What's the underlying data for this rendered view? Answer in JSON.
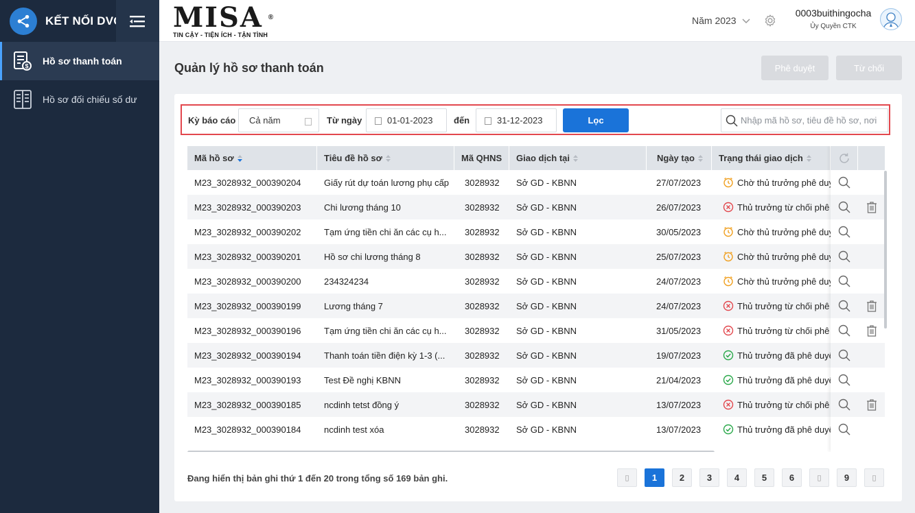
{
  "sidebar": {
    "app_title": "KẾT NỐI DVC",
    "items": [
      {
        "label": "Hồ sơ thanh toán",
        "active": true
      },
      {
        "label": "Hồ sơ đối chiếu số dư",
        "active": false
      }
    ]
  },
  "header": {
    "brand": "MISA",
    "brand_reg": "®",
    "tagline": "TIN CẬY - TIỆN ÍCH - TẬN TÌNH",
    "year": "Năm 2023",
    "user_name": "0003buithingocha",
    "user_role": "Ủy Quyền CTK"
  },
  "page": {
    "title": "Quản lý hồ sơ thanh toán",
    "approve_label": "Phê duyệt",
    "reject_label": "Từ chối"
  },
  "filter": {
    "period_label": "Kỳ báo cáo",
    "period_value": "Cả năm",
    "from_label": "Từ ngày",
    "from_value": "01-01-2023",
    "to_label": "đến",
    "to_value": "31-12-2023",
    "filter_button": "Lọc",
    "search_placeholder": "Nhập mã hồ sơ, tiêu đề hồ sơ, nơi"
  },
  "table": {
    "columns": [
      "Mã hồ sơ",
      "Tiêu đề hồ sơ",
      "Mã QHNS",
      "Giao dịch tại",
      "Ngày tạo",
      "Trạng thái giao dịch"
    ],
    "rows": [
      {
        "code": "M23_3028932_000390204",
        "title": "Giấy rút dự toán lương phụ cấp",
        "qhns": "3028932",
        "place": "Sở GD - KBNN",
        "date": "27/07/2023",
        "status": "Chờ thủ trưởng phê duy",
        "status_type": "pending",
        "deletable": false
      },
      {
        "code": "M23_3028932_000390203",
        "title": "Chi lương tháng 10",
        "qhns": "3028932",
        "place": "Sở GD - KBNN",
        "date": "26/07/2023",
        "status": "Thủ trưởng từ chối phê",
        "status_type": "rejected",
        "deletable": true
      },
      {
        "code": "M23_3028932_000390202",
        "title": "Tạm ứng tiền chi ăn các cụ h...",
        "qhns": "3028932",
        "place": "Sở GD - KBNN",
        "date": "30/05/2023",
        "status": "Chờ thủ trưởng phê duy",
        "status_type": "pending",
        "deletable": false
      },
      {
        "code": "M23_3028932_000390201",
        "title": "Hồ sơ chi lương tháng 8",
        "qhns": "3028932",
        "place": "Sở GD - KBNN",
        "date": "25/07/2023",
        "status": "Chờ thủ trưởng phê duy",
        "status_type": "pending",
        "deletable": false
      },
      {
        "code": "M23_3028932_000390200",
        "title": "234324234",
        "qhns": "3028932",
        "place": "Sở GD - KBNN",
        "date": "24/07/2023",
        "status": "Chờ thủ trưởng phê duy",
        "status_type": "pending",
        "deletable": false
      },
      {
        "code": "M23_3028932_000390199",
        "title": "Lương tháng 7",
        "qhns": "3028932",
        "place": "Sở GD - KBNN",
        "date": "24/07/2023",
        "status": "Thủ trưởng từ chối phê",
        "status_type": "rejected",
        "deletable": true
      },
      {
        "code": "M23_3028932_000390196",
        "title": "Tạm ứng tiền chi ăn các cụ h...",
        "qhns": "3028932",
        "place": "Sở GD - KBNN",
        "date": "31/05/2023",
        "status": "Thủ trưởng từ chối phê",
        "status_type": "rejected",
        "deletable": true
      },
      {
        "code": "M23_3028932_000390194",
        "title": "Thanh toán tiền điện kỳ 1-3 (...",
        "qhns": "3028932",
        "place": "Sở GD - KBNN",
        "date": "19/07/2023",
        "status": "Thủ trưởng đã phê duyệ",
        "status_type": "approved",
        "deletable": false
      },
      {
        "code": "M23_3028932_000390193",
        "title": "Test Đề nghị KBNN",
        "qhns": "3028932",
        "place": "Sở GD - KBNN",
        "date": "21/04/2023",
        "status": "Thủ trưởng đã phê duyệ",
        "status_type": "approved",
        "deletable": false
      },
      {
        "code": "M23_3028932_000390185",
        "title": "ncdinh tetst đồng ý",
        "qhns": "3028932",
        "place": "Sở GD - KBNN",
        "date": "13/07/2023",
        "status": "Thủ trưởng từ chối phê",
        "status_type": "rejected",
        "deletable": true
      },
      {
        "code": "M23_3028932_000390184",
        "title": "ncdinh test xóa",
        "qhns": "3028932",
        "place": "Sở GD - KBNN",
        "date": "13/07/2023",
        "status": "Thủ trưởng đã phê duyệ",
        "status_type": "approved",
        "deletable": false
      }
    ]
  },
  "footer": {
    "info": "Đang hiển thị bản ghi thứ 1 đến 20 trong tổng số 169 bản ghi.",
    "pages": [
      "1",
      "2",
      "3",
      "4",
      "5",
      "6",
      "9"
    ],
    "current_page": "1"
  },
  "colors": {
    "sidebar_bg": "#1c2a3e",
    "accent": "#1a73d9",
    "pending": "#f0a020",
    "rejected": "#e2474d",
    "approved": "#2aa84a",
    "highlight_border": "#e2474d"
  },
  "icons": {
    "app_logo": "share-icon",
    "menu_toggle": "menu-icon",
    "doc_payment": "payment-document-icon",
    "doc_compare": "compare-document-icon",
    "settings": "gear-icon",
    "refresh": "refresh-icon",
    "view": "search-icon",
    "delete": "trash-icon",
    "calendar": "calendar-icon"
  }
}
